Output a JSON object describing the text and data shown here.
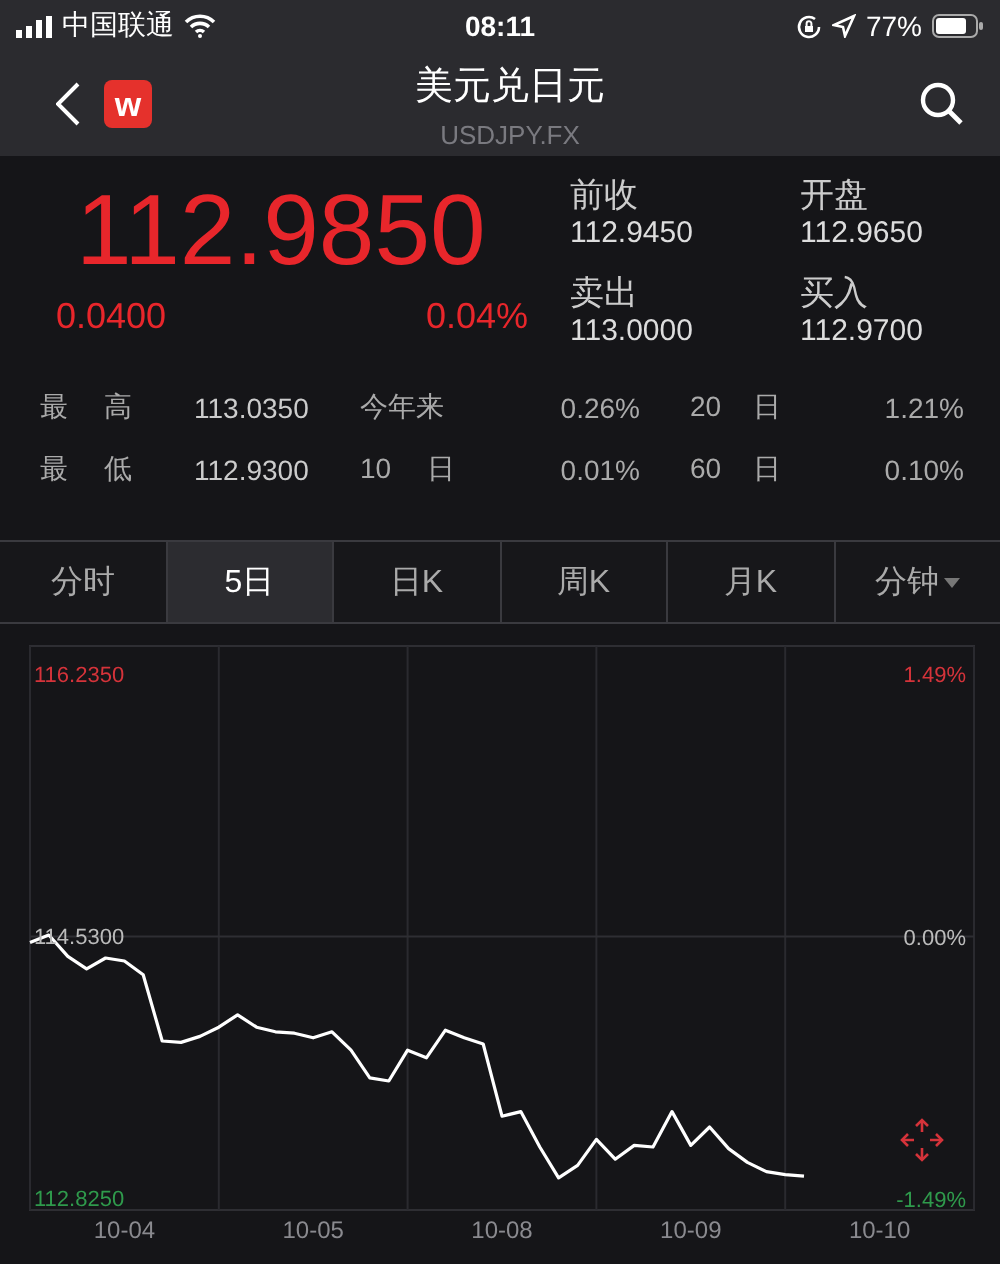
{
  "status_bar": {
    "carrier": "中国联通",
    "time": "08:11",
    "battery": "77%"
  },
  "nav": {
    "badge": "w",
    "title": "美元兑日元",
    "subtitle": "USDJPY.FX"
  },
  "quote": {
    "price": "112.9850",
    "change": "0.0400",
    "change_pct": "0.04%",
    "stats": [
      {
        "label": "前收",
        "value": "112.9450"
      },
      {
        "label": "开盘",
        "value": "112.9650"
      },
      {
        "label": "卖出",
        "value": "113.0000"
      },
      {
        "label": "买入",
        "value": "112.9700"
      }
    ]
  },
  "ranges": [
    [
      "最 高",
      "113.0350",
      "今年来",
      "0.26%",
      "20 日",
      "1.21%"
    ],
    [
      "最 低",
      "112.9300",
      "10 日",
      "0.01%",
      "60 日",
      "0.10%"
    ]
  ],
  "tabs": [
    {
      "label": "分时",
      "selected": false,
      "dropdown": false
    },
    {
      "label": "5日",
      "selected": true,
      "dropdown": false
    },
    {
      "label": "日K",
      "selected": false,
      "dropdown": false
    },
    {
      "label": "周K",
      "selected": false,
      "dropdown": false
    },
    {
      "label": "月K",
      "selected": false,
      "dropdown": false
    },
    {
      "label": "分钟",
      "selected": false,
      "dropdown": true
    }
  ],
  "chart": {
    "chart_data": {
      "type": "line",
      "grid": true,
      "categories": [
        null,
        null,
        null,
        null,
        null,
        "10-04",
        null,
        null,
        null,
        null,
        null,
        null,
        null,
        null,
        null,
        "10-05",
        null,
        null,
        null,
        null,
        null,
        null,
        null,
        null,
        null,
        "10-08",
        null,
        null,
        null,
        null,
        null,
        null,
        null,
        null,
        null,
        "10-09",
        null,
        null,
        null,
        null,
        null,
        null,
        null,
        null,
        null,
        "10-10",
        null,
        null,
        null,
        null
      ],
      "series": [
        {
          "color": "#ffffff",
          "values": [
            114.49,
            114.54,
            114.4,
            114.32,
            114.39,
            114.37,
            114.28,
            113.85,
            113.84,
            113.88,
            113.94,
            114.02,
            113.94,
            113.91,
            113.9,
            113.87,
            113.91,
            113.79,
            113.61,
            113.59,
            113.79,
            113.74,
            113.92,
            113.87,
            113.83,
            113.36,
            113.39,
            113.16,
            112.96,
            113.04,
            113.21,
            113.08,
            113.17,
            113.16,
            113.39,
            113.17,
            113.29,
            113.15,
            113.06,
            113.0,
            112.98,
            112.97,
            null,
            null,
            null,
            null,
            null,
            null,
            null,
            null
          ]
        }
      ],
      "ylim": [
        112.75,
        116.42
      ],
      "y2lim": [
        -1.55,
        1.65
      ],
      "yticks": [
        {
          "value": 116.235,
          "label": "116.2350"
        },
        {
          "value": 114.53,
          "label": "114.5300"
        },
        {
          "value": 112.825,
          "label": "112.8250"
        }
      ],
      "y2ticks": [
        {
          "value": 1.49,
          "label": "1.49%"
        },
        {
          "value": 0,
          "label": "0.00%"
        },
        {
          "value": -1.49,
          "label": "-1.49%"
        }
      ]
    }
  }
}
